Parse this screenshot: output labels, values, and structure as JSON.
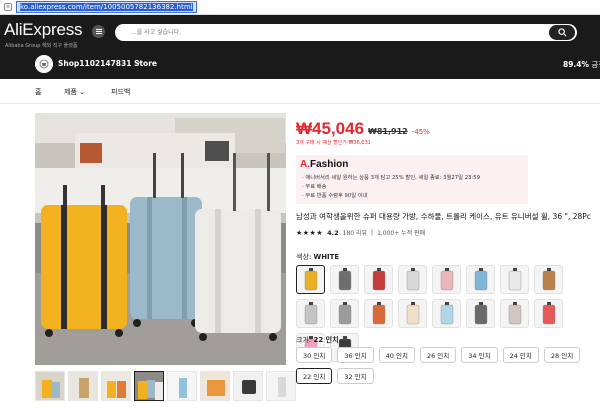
{
  "browser": {
    "url": "ko.aliexpress.com/item/1005005782136382.html"
  },
  "header": {
    "logo": "AliExpress",
    "logo_sub": "Alibaba Group 해외 직구 플랫폼",
    "search_placeholder": "...을 사고 싶습니다."
  },
  "store": {
    "name": "Shop1102147831 Store",
    "rating_value": "89.4%",
    "rating_label": "긍정"
  },
  "tabs": [
    {
      "label": "홈"
    },
    {
      "label": "제품"
    },
    {
      "label": "피드백"
    }
  ],
  "product": {
    "price": "₩45,046",
    "old_price": "₩81,912",
    "discount": "-45%",
    "bulk_note": "3개 구매 시 예상 할인가 ₩36,031",
    "promo": {
      "brand_a": "A.",
      "brand_rest": "Fashion",
      "lines": [
        "· 애니버서리 세일  원하는 상품 3개 담고 25% 할인, 세일 종료: 3월27일 23:59",
        "· 무료 배송",
        "· 무료 반품 수령후 90일 이내"
      ]
    },
    "title": "남성과 여학생을위한 슈퍼 대용량 가방, 수하물, 트롤리 케이스, 유트 유니버설 휠, 36 \", 28Pc",
    "rating": {
      "stars": "★★★★",
      "score": "4.2",
      "reviews": "180 리뷰",
      "sold": "1,000+ 누적 판매"
    },
    "color_prefix": "색상: ",
    "color_value": "WHITE",
    "size_prefix": "크기: ",
    "size_value": "22 인치",
    "sizes": [
      "30 인치",
      "36 인치",
      "40 인치",
      "26 인치",
      "34 인치",
      "24 인치",
      "28 인치",
      "22 인치",
      "32 인치"
    ],
    "selected_size_index": 7,
    "swatch_colors": [
      "#e8b025",
      "#6e6e6e",
      "#c43b3b",
      "#d8d8d8",
      "#e9b7b7",
      "#7fb6d8",
      "#e8e8e8",
      "#b9824a",
      "#c4c4c4",
      "#9b9b9b",
      "#d96a3a",
      "#f0e0c8",
      "#b0d6e8",
      "#6a6a6a",
      "#d0c5c0",
      "#e45a5a",
      "#f0a0b8",
      "#3a3a3a"
    ],
    "selected_swatch_index": 0
  },
  "colors": {
    "accent": "#e0282e",
    "header_bg": "#1a1a1a"
  }
}
